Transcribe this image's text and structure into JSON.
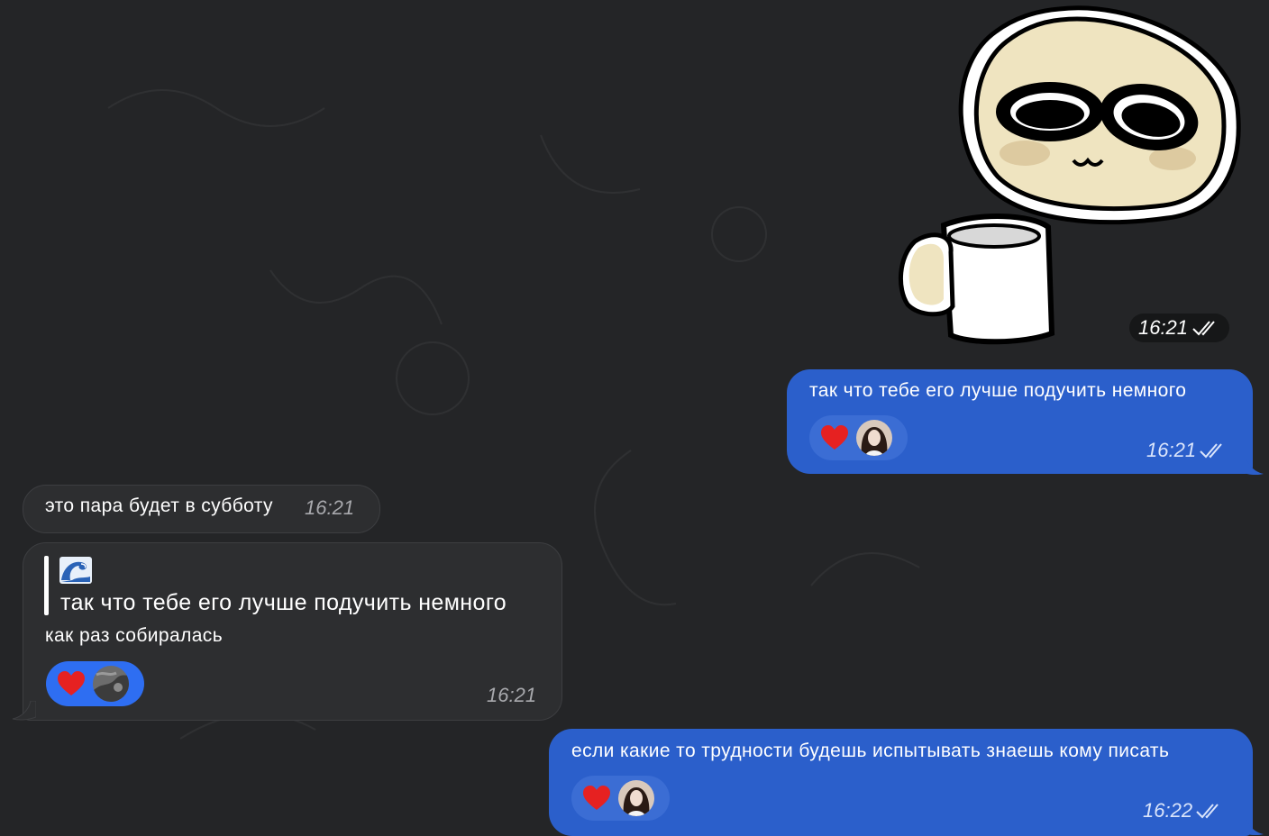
{
  "colors": {
    "background": "#242527",
    "outgoing_bubble": "#2b5fcb",
    "incoming_bubble": "#2d2e30",
    "reaction_out": "#3b6dd4",
    "reaction_in": "#2e6ef2"
  },
  "messages": {
    "sticker": {
      "icon": "coffee-mug-face-sticker",
      "time": "16:21",
      "status": "read"
    },
    "out1": {
      "text": "так что тебе его лучше подучить немного",
      "time": "16:21",
      "status": "read",
      "reactions": [
        {
          "emoji": "heart",
          "avatar": "girl-avatar"
        }
      ]
    },
    "in1": {
      "text": "это пара будет в субботу",
      "time": "16:21"
    },
    "in2": {
      "reply_emoji": "wave",
      "quote": "так что тебе его лучше подучить немного",
      "text": "как раз собиралась",
      "time": "16:21",
      "reactions": [
        {
          "emoji": "heart",
          "avatar": "gray-avatar"
        }
      ]
    },
    "out2": {
      "text": "если какие то трудности будешь испытывать знаешь кому писать",
      "time": "16:22",
      "status": "read",
      "reactions": [
        {
          "emoji": "heart",
          "avatar": "girl-avatar"
        }
      ]
    }
  }
}
